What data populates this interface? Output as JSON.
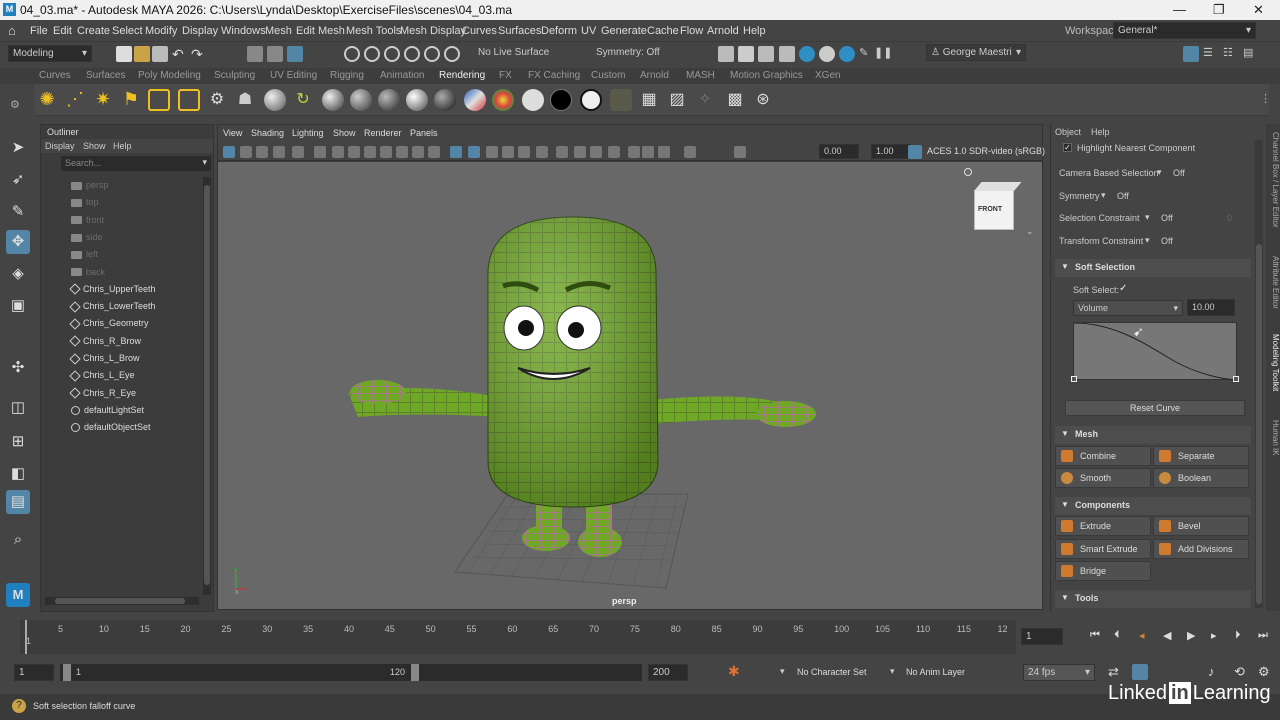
{
  "titlebar": {
    "title": "04_03.ma* - Autodesk MAYA 2026: C:\\Users\\Lynda\\Desktop\\ExerciseFiles\\scenes\\04_03.ma",
    "logo": "M",
    "minimize": "—",
    "maximize": "❐",
    "close": "✕"
  },
  "menus": [
    "File",
    "Edit",
    "Create",
    "Select",
    "Modify",
    "Display",
    "Windows",
    "Mesh",
    "Edit Mesh",
    "Mesh Tools",
    "Mesh Display",
    "Curves",
    "Surfaces",
    "Deform",
    "UV",
    "Generate",
    "Cache",
    "Flow",
    "Arnold",
    "Help"
  ],
  "workspace": {
    "label": "Workspace:",
    "value": "General*"
  },
  "statusline": {
    "mode": "Modeling",
    "live_surface": "No Live Surface",
    "symmetry": "Symmetry: Off",
    "user": "George Maestri"
  },
  "shelf_tabs": [
    "Curves",
    "Surfaces",
    "Poly Modeling",
    "Sculpting",
    "UV Editing",
    "Rigging",
    "Animation",
    "Rendering",
    "FX",
    "FX Caching",
    "Custom",
    "Arnold",
    "MASH",
    "Motion Graphics",
    "XGen"
  ],
  "active_shelf": "Rendering",
  "outliner": {
    "title": "Outliner",
    "menus": [
      "Display",
      "Show",
      "Help"
    ],
    "search_placeholder": "Search...",
    "items": [
      {
        "label": "persp",
        "kind": "camera"
      },
      {
        "label": "top",
        "kind": "camera"
      },
      {
        "label": "front",
        "kind": "camera"
      },
      {
        "label": "side",
        "kind": "camera"
      },
      {
        "label": "left",
        "kind": "camera"
      },
      {
        "label": "back",
        "kind": "camera"
      },
      {
        "label": "Chris_UpperTeeth",
        "kind": "mesh"
      },
      {
        "label": "Chris_LowerTeeth",
        "kind": "mesh"
      },
      {
        "label": "Chris_Geometry",
        "kind": "mesh"
      },
      {
        "label": "Chris_R_Brow",
        "kind": "mesh"
      },
      {
        "label": "Chris_L_Brow",
        "kind": "mesh"
      },
      {
        "label": "Chris_L_Eye",
        "kind": "mesh"
      },
      {
        "label": "Chris_R_Eye",
        "kind": "mesh"
      },
      {
        "label": "defaultLightSet",
        "kind": "set"
      },
      {
        "label": "defaultObjectSet",
        "kind": "set"
      }
    ]
  },
  "viewport": {
    "menus": [
      "View",
      "Shading",
      "Lighting",
      "Show",
      "Renderer",
      "Panels"
    ],
    "near_value": "0.00",
    "far_value": "1.00",
    "color_space": "ACES 1.0 SDR-video (sRGB)",
    "cube_label": "FRONT",
    "camera_label": "persp"
  },
  "modeling_toolkit": {
    "menus": [
      "Object",
      "Help"
    ],
    "highlight_nearest": "Highlight Nearest Component",
    "camera_based": {
      "label": "Camera Based Selection",
      "value": "Off"
    },
    "symmetry": {
      "label": "Symmetry",
      "value": "Off"
    },
    "selection_constraint": {
      "label": "Selection Constraint",
      "value": "Off",
      "extra": "0"
    },
    "transform_constraint": {
      "label": "Transform Constraint",
      "value": "Off"
    },
    "soft_selection": {
      "header": "Soft Selection",
      "toggle_label": "Soft Select:",
      "mode": "Volume",
      "radius": "10.00",
      "reset": "Reset Curve"
    },
    "mesh": {
      "header": "Mesh",
      "buttons": [
        "Combine",
        "Separate",
        "Smooth",
        "Boolean"
      ]
    },
    "components": {
      "header": "Components",
      "buttons": [
        "Extrude",
        "Bevel",
        "Smart Extrude",
        "Add Divisions",
        "Bridge"
      ]
    },
    "tools_header": "Tools"
  },
  "side_tabs": [
    "Channel Box / Layer Editor",
    "Attribute Editor",
    "Modeling Toolkit",
    "Human IK"
  ],
  "timeline": {
    "ticks": [
      "1",
      "5",
      "10",
      "15",
      "20",
      "25",
      "30",
      "35",
      "40",
      "45",
      "50",
      "55",
      "60",
      "65",
      "70",
      "75",
      "80",
      "85",
      "90",
      "95",
      "100",
      "105",
      "110",
      "115",
      "12"
    ],
    "current_frame": "1"
  },
  "range": {
    "start": "1",
    "inner_start": "1",
    "inner_end": "120",
    "end": "200",
    "character_set": "No Character Set",
    "anim_layer": "No Anim Layer",
    "fps": "24 fps"
  },
  "helpline": {
    "text": "Soft selection falloff curve"
  },
  "watermark": "Linked in Learning",
  "colors": {
    "accent": "#5285a6",
    "body_green": "#6fa827",
    "wire_magenta": "#d04fd0"
  }
}
